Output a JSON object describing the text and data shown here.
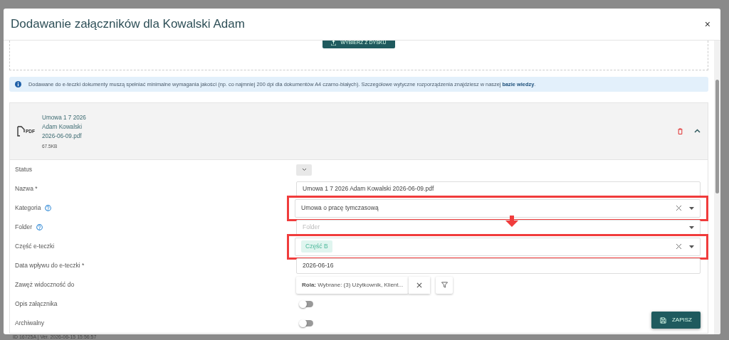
{
  "dialog": {
    "title": "Dodawanie załączników dla Kowalski Adam",
    "close": "×"
  },
  "upload": {
    "button": "WYBIERZ Z DYSKU"
  },
  "info": {
    "text": "Dodawane do e-teczki dokumenty muszą spełniać minimalne wymagania jakości (np. co najmniej 200 dpi dla dokumentów A4 czarno-białych). Szczegółowe wytyczne rozporządzenia znajdziesz w naszej",
    "link": "bazie wiedzy",
    "end": "."
  },
  "attachment": {
    "file_type": "PDF",
    "file_name": "Umowa 1 7 2026 Adam Kowalski 2026-06-09.pdf",
    "size": "67.5KB",
    "expanded": true
  },
  "fields": [
    {
      "kind": "status",
      "label": "Status",
      "help": false,
      "highlighted": false
    },
    {
      "kind": "text",
      "label": "Nazwa *",
      "help": false,
      "highlighted": false,
      "value": "Umowa 1 7 2026 Adam Kowalski 2026-06-09.pdf"
    },
    {
      "kind": "select",
      "label": "Kategoria",
      "help": true,
      "highlighted": true,
      "value": "Umowa o pracę tymczasową"
    },
    {
      "kind": "select",
      "label": "Folder",
      "help": true,
      "highlighted": false,
      "placeholder": "Folder"
    },
    {
      "kind": "tags",
      "label": "Część e-teczki",
      "help": false,
      "highlighted": true,
      "tags": [
        "Część B"
      ]
    },
    {
      "kind": "text",
      "label": "Data wpływu do e-teczki *",
      "help": false,
      "highlighted": false,
      "value": "2026-06-16"
    },
    {
      "kind": "filter",
      "label": "Zawęż widoczność do",
      "help": false,
      "highlighted": false,
      "value": "**Rola:** Wybrane: (3) Użytkownik, Klient..."
    },
    {
      "kind": "toggle",
      "label": "Opis załącznika",
      "help": false,
      "highlighted": false,
      "on": false
    },
    {
      "kind": "toggle",
      "label": "Archiwalny",
      "help": false,
      "highlighted": false,
      "on": false
    }
  ],
  "save_button": "ZAPISZ",
  "footer": "ID 16725A | Ver. 2026-06-15 15:56:57"
}
